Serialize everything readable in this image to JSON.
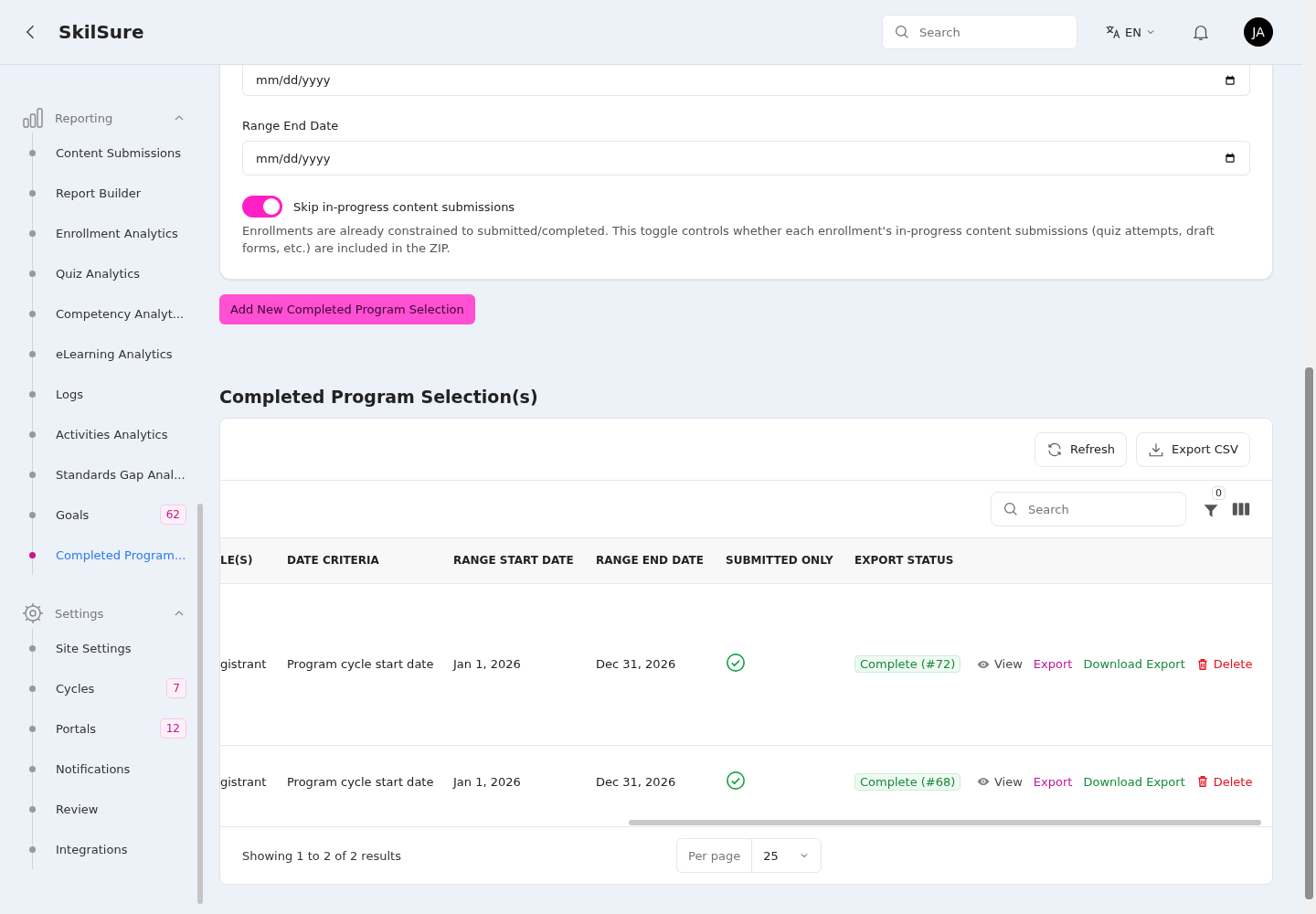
{
  "header": {
    "title": "SkilSure",
    "search": {
      "placeholder": "Search"
    },
    "language": "EN",
    "avatar": "JA"
  },
  "sidebar": {
    "sections": [
      {
        "title": "Reporting",
        "kind": "chart",
        "expanded": true,
        "items": [
          {
            "label": "Content Submissions",
            "selected": false
          },
          {
            "label": "Report Builder",
            "selected": false
          },
          {
            "label": "Enrollment Analytics",
            "selected": false
          },
          {
            "label": "Quiz Analytics",
            "selected": false
          },
          {
            "label": "Competency Analyt...",
            "selected": false
          },
          {
            "label": "eLearning Analytics",
            "selected": false
          },
          {
            "label": "Logs",
            "selected": false
          },
          {
            "label": "Activities Analytics",
            "selected": false
          },
          {
            "label": "Standards Gap Anal...",
            "selected": false
          },
          {
            "label": "Goals",
            "badge": "62",
            "selected": false
          },
          {
            "label": "Completed Program...",
            "selected": true
          }
        ]
      },
      {
        "title": "Settings",
        "kind": "gear",
        "expanded": true,
        "items": [
          {
            "label": "Site Settings",
            "selected": false
          },
          {
            "label": "Cycles",
            "badge": "7",
            "selected": false
          },
          {
            "label": "Portals",
            "badge": "12",
            "selected": false
          },
          {
            "label": "Notifications",
            "selected": false
          },
          {
            "label": "Review",
            "selected": false
          },
          {
            "label": "Integrations",
            "selected": false
          }
        ]
      }
    ]
  },
  "form": {
    "start_date": {
      "value": "mm/dd/yyyy"
    },
    "end_date": {
      "label": "Range End Date",
      "value": "mm/dd/yyyy"
    },
    "toggle": {
      "label": "Skip in-progress content submissions",
      "on": true
    },
    "help": "Enrollments are already constrained to submitted/completed. This toggle controls whether each enrollment's in-progress content submissions (quiz attempts, draft forms, etc.) are included in the ZIP."
  },
  "add_button": "Add New Completed Program Selection",
  "section_title": "Completed Program Selection(s)",
  "table": {
    "toolbar": [
      {
        "label": "Refresh",
        "kind": "refresh"
      },
      {
        "label": "Export CSV",
        "kind": "export"
      }
    ],
    "search": {
      "placeholder": "Search"
    },
    "filter_count": "0",
    "columns": [
      "LE(S)",
      "DATE CRITERIA",
      "RANGE START DATE",
      "RANGE END DATE",
      "SUBMITTED ONLY",
      "EXPORT STATUS"
    ],
    "rows": [
      {
        "column_1": "gistrant",
        "date_criteria": "Program cycle start date",
        "start": "Jan 1, 2026",
        "end": "Dec 31, 2026",
        "submitted_only": true,
        "status": "Complete (#72)",
        "tall": true,
        "actions": [
          {
            "label": "View",
            "kind": "view"
          },
          {
            "label": "Export",
            "kind": "export"
          },
          {
            "label": "Download Export",
            "kind": "download"
          },
          {
            "label": "Delete",
            "kind": "delete"
          }
        ]
      },
      {
        "column_1": "gistrant",
        "date_criteria": "Program cycle start date",
        "start": "Jan 1, 2026",
        "end": "Dec 31, 2026",
        "submitted_only": true,
        "status": "Complete (#68)",
        "tall": false,
        "actions": [
          {
            "label": "View",
            "kind": "view"
          },
          {
            "label": "Export",
            "kind": "export"
          },
          {
            "label": "Download Export",
            "kind": "download"
          },
          {
            "label": "Delete",
            "kind": "delete"
          }
        ]
      }
    ],
    "footer": {
      "summary": "Showing 1 to 2 of 2 results",
      "per_page_label": "Per page",
      "per_page": "25"
    }
  }
}
